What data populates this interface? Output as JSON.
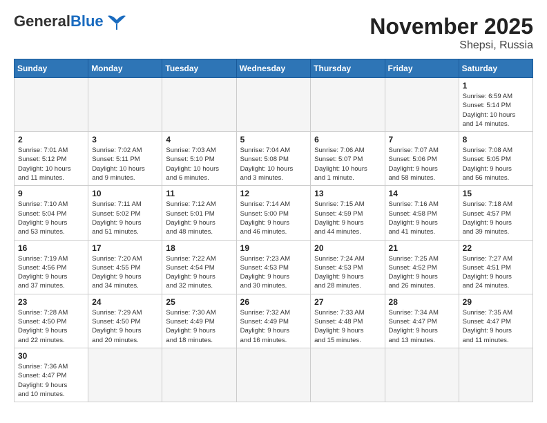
{
  "header": {
    "logo_general": "General",
    "logo_blue": "Blue",
    "month": "November 2025",
    "location": "Shepsi, Russia"
  },
  "weekdays": [
    "Sunday",
    "Monday",
    "Tuesday",
    "Wednesday",
    "Thursday",
    "Friday",
    "Saturday"
  ],
  "days": [
    {
      "num": "",
      "info": ""
    },
    {
      "num": "",
      "info": ""
    },
    {
      "num": "",
      "info": ""
    },
    {
      "num": "",
      "info": ""
    },
    {
      "num": "",
      "info": ""
    },
    {
      "num": "",
      "info": ""
    },
    {
      "num": "1",
      "info": "Sunrise: 6:59 AM\nSunset: 5:14 PM\nDaylight: 10 hours\nand 14 minutes."
    },
    {
      "num": "2",
      "info": "Sunrise: 7:01 AM\nSunset: 5:12 PM\nDaylight: 10 hours\nand 11 minutes."
    },
    {
      "num": "3",
      "info": "Sunrise: 7:02 AM\nSunset: 5:11 PM\nDaylight: 10 hours\nand 9 minutes."
    },
    {
      "num": "4",
      "info": "Sunrise: 7:03 AM\nSunset: 5:10 PM\nDaylight: 10 hours\nand 6 minutes."
    },
    {
      "num": "5",
      "info": "Sunrise: 7:04 AM\nSunset: 5:08 PM\nDaylight: 10 hours\nand 3 minutes."
    },
    {
      "num": "6",
      "info": "Sunrise: 7:06 AM\nSunset: 5:07 PM\nDaylight: 10 hours\nand 1 minute."
    },
    {
      "num": "7",
      "info": "Sunrise: 7:07 AM\nSunset: 5:06 PM\nDaylight: 9 hours\nand 58 minutes."
    },
    {
      "num": "8",
      "info": "Sunrise: 7:08 AM\nSunset: 5:05 PM\nDaylight: 9 hours\nand 56 minutes."
    },
    {
      "num": "9",
      "info": "Sunrise: 7:10 AM\nSunset: 5:04 PM\nDaylight: 9 hours\nand 53 minutes."
    },
    {
      "num": "10",
      "info": "Sunrise: 7:11 AM\nSunset: 5:02 PM\nDaylight: 9 hours\nand 51 minutes."
    },
    {
      "num": "11",
      "info": "Sunrise: 7:12 AM\nSunset: 5:01 PM\nDaylight: 9 hours\nand 48 minutes."
    },
    {
      "num": "12",
      "info": "Sunrise: 7:14 AM\nSunset: 5:00 PM\nDaylight: 9 hours\nand 46 minutes."
    },
    {
      "num": "13",
      "info": "Sunrise: 7:15 AM\nSunset: 4:59 PM\nDaylight: 9 hours\nand 44 minutes."
    },
    {
      "num": "14",
      "info": "Sunrise: 7:16 AM\nSunset: 4:58 PM\nDaylight: 9 hours\nand 41 minutes."
    },
    {
      "num": "15",
      "info": "Sunrise: 7:18 AM\nSunset: 4:57 PM\nDaylight: 9 hours\nand 39 minutes."
    },
    {
      "num": "16",
      "info": "Sunrise: 7:19 AM\nSunset: 4:56 PM\nDaylight: 9 hours\nand 37 minutes."
    },
    {
      "num": "17",
      "info": "Sunrise: 7:20 AM\nSunset: 4:55 PM\nDaylight: 9 hours\nand 34 minutes."
    },
    {
      "num": "18",
      "info": "Sunrise: 7:22 AM\nSunset: 4:54 PM\nDaylight: 9 hours\nand 32 minutes."
    },
    {
      "num": "19",
      "info": "Sunrise: 7:23 AM\nSunset: 4:53 PM\nDaylight: 9 hours\nand 30 minutes."
    },
    {
      "num": "20",
      "info": "Sunrise: 7:24 AM\nSunset: 4:53 PM\nDaylight: 9 hours\nand 28 minutes."
    },
    {
      "num": "21",
      "info": "Sunrise: 7:25 AM\nSunset: 4:52 PM\nDaylight: 9 hours\nand 26 minutes."
    },
    {
      "num": "22",
      "info": "Sunrise: 7:27 AM\nSunset: 4:51 PM\nDaylight: 9 hours\nand 24 minutes."
    },
    {
      "num": "23",
      "info": "Sunrise: 7:28 AM\nSunset: 4:50 PM\nDaylight: 9 hours\nand 22 minutes."
    },
    {
      "num": "24",
      "info": "Sunrise: 7:29 AM\nSunset: 4:50 PM\nDaylight: 9 hours\nand 20 minutes."
    },
    {
      "num": "25",
      "info": "Sunrise: 7:30 AM\nSunset: 4:49 PM\nDaylight: 9 hours\nand 18 minutes."
    },
    {
      "num": "26",
      "info": "Sunrise: 7:32 AM\nSunset: 4:49 PM\nDaylight: 9 hours\nand 16 minutes."
    },
    {
      "num": "27",
      "info": "Sunrise: 7:33 AM\nSunset: 4:48 PM\nDaylight: 9 hours\nand 15 minutes."
    },
    {
      "num": "28",
      "info": "Sunrise: 7:34 AM\nSunset: 4:47 PM\nDaylight: 9 hours\nand 13 minutes."
    },
    {
      "num": "29",
      "info": "Sunrise: 7:35 AM\nSunset: 4:47 PM\nDaylight: 9 hours\nand 11 minutes."
    },
    {
      "num": "30",
      "info": "Sunrise: 7:36 AM\nSunset: 4:47 PM\nDaylight: 9 hours\nand 10 minutes."
    },
    {
      "num": "",
      "info": ""
    },
    {
      "num": "",
      "info": ""
    },
    {
      "num": "",
      "info": ""
    },
    {
      "num": "",
      "info": ""
    },
    {
      "num": "",
      "info": ""
    },
    {
      "num": "",
      "info": ""
    }
  ]
}
